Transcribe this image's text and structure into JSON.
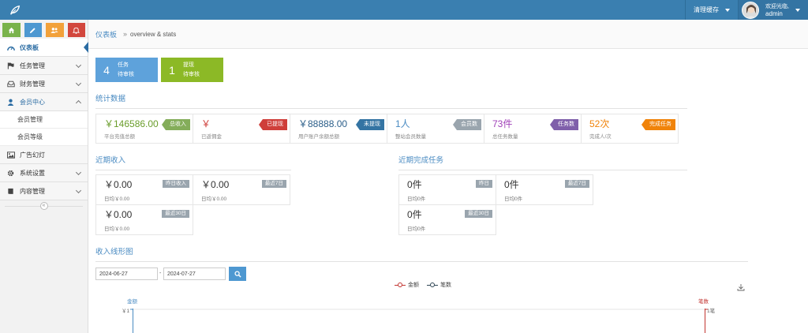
{
  "colors": {
    "topbar": "#3a7fb0",
    "accent": "#4a8bc2",
    "tile_blue": "#5ea2db",
    "tile_green": "#8cb926",
    "income_green": "#6a9d2b",
    "red": "#cf3e3a",
    "navy": "#2c5f8a",
    "purple": "#a040b8",
    "orange": "#f0830a"
  },
  "topbar": {
    "logo_icon": "leaf-icon",
    "clear_cache": "清理缓存",
    "welcome": "欢迎光临,",
    "username": "admin"
  },
  "sidebar": {
    "shortcuts": [
      {
        "icon": "home-icon"
      },
      {
        "icon": "pencil-icon"
      },
      {
        "icon": "users-icon"
      },
      {
        "icon": "bell-icon"
      }
    ],
    "menu": {
      "dashboard": "仪表板",
      "tasks": "任务管理",
      "finance": "财务管理",
      "members": "会员中心",
      "member_manage": "会员管理",
      "member_level": "会员等级",
      "ads": "广告幻灯",
      "settings": "系统设置",
      "content": "内容管理"
    }
  },
  "breadcrumb": {
    "home": "仪表板",
    "sub": "overview & stats"
  },
  "task_tiles": [
    {
      "num": "4",
      "line1": "任务",
      "line2": "待审核"
    },
    {
      "num": "1",
      "line1": "提现",
      "line2": "待审核"
    }
  ],
  "stats_title": "统计数据",
  "stats": [
    {
      "value": "￥146586.00",
      "label": "平台充值总额",
      "tag": "总收入"
    },
    {
      "value": "￥",
      "label": "已返佣金",
      "tag": "已提现"
    },
    {
      "value": "￥88888.00",
      "label": "用户账户余额总额",
      "tag": "未提现"
    },
    {
      "value": "1人",
      "label": "整站会员数量",
      "tag": "会员数"
    },
    {
      "value": "73件",
      "label": "总任务数量",
      "tag": "任务数"
    },
    {
      "value": "52次",
      "label": "完成人/次",
      "tag": "完成任务"
    }
  ],
  "recent_income": {
    "title": "近期收入",
    "cards": [
      {
        "value": "￥0.00",
        "sub": "日均￥0.00",
        "tag": "昨日收入"
      },
      {
        "value": "￥0.00",
        "sub": "日均￥0.00",
        "tag": "最近7日"
      },
      {
        "value": "￥0.00",
        "sub": "日均￥0.00",
        "tag": "最近30日"
      }
    ]
  },
  "recent_tasks": {
    "title": "近期完成任务",
    "cards": [
      {
        "value": "0件",
        "sub": "日均0件",
        "tag": "昨日"
      },
      {
        "value": "0件",
        "sub": "日均0件",
        "tag": "最近7日"
      },
      {
        "value": "0件",
        "sub": "日均0件",
        "tag": "最近30日"
      }
    ]
  },
  "line_chart": {
    "title": "收入线形图",
    "date_from": "2024-06-27",
    "date_to": "2024-07-27",
    "dash": "-",
    "legend": [
      "金额",
      "笔数"
    ],
    "left_axis_name": "金额",
    "right_axis_name": "笔数",
    "left_tick": "￥1",
    "right_tick": "1笔"
  }
}
